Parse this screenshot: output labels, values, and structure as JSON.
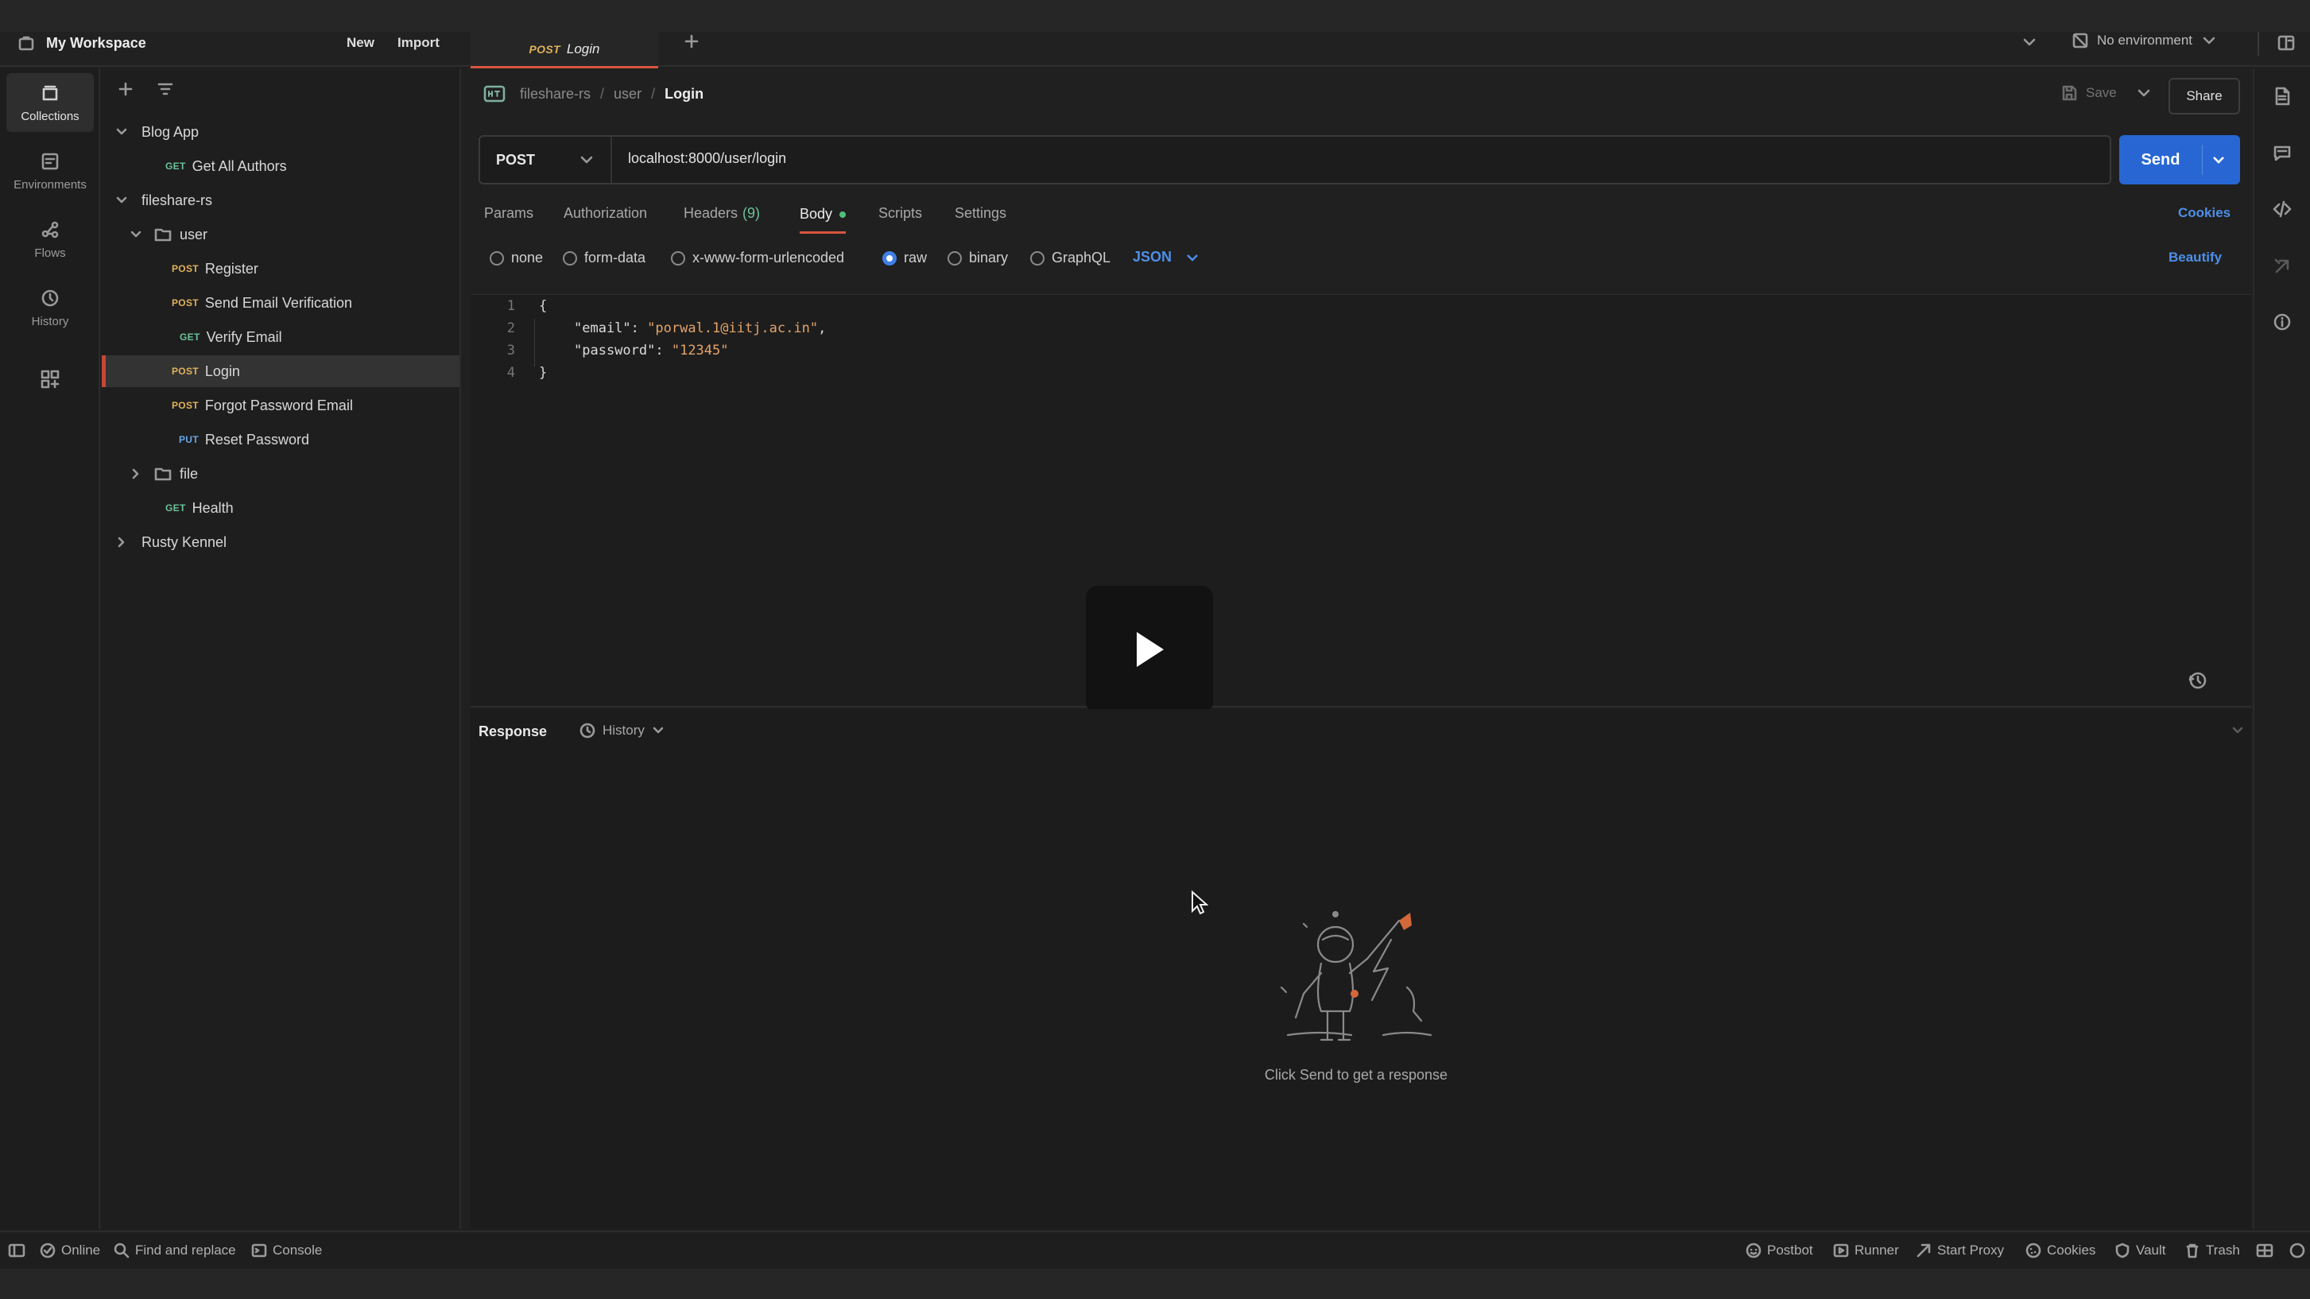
{
  "workspace": {
    "name": "My Workspace",
    "new_label": "New",
    "import_label": "Import"
  },
  "tabs": [
    {
      "method": "POST",
      "label": "Login"
    }
  ],
  "environment": {
    "label": "No environment"
  },
  "rail": {
    "items": [
      {
        "label": "Collections",
        "icon": "collections-icon"
      },
      {
        "label": "Environments",
        "icon": "environments-icon"
      },
      {
        "label": "Flows",
        "icon": "flows-icon"
      },
      {
        "label": "History",
        "icon": "history-icon"
      }
    ]
  },
  "sidebar": {
    "tree": {
      "blog_app": "Blog App",
      "get_all_authors": {
        "method": "GET",
        "label": "Get All Authors"
      },
      "fileshare": "fileshare-rs",
      "user_folder": "user",
      "register": {
        "method": "POST",
        "label": "Register"
      },
      "send_email": {
        "method": "POST",
        "label": "Send Email Verification"
      },
      "verify_email": {
        "method": "GET",
        "label": "Verify Email"
      },
      "login": {
        "method": "POST",
        "label": "Login"
      },
      "forgot": {
        "method": "POST",
        "label": "Forgot Password Email"
      },
      "reset": {
        "method": "PUT",
        "label": "Reset Password"
      },
      "file_folder": "file",
      "health": {
        "method": "GET",
        "label": "Health"
      },
      "rusty": "Rusty Kennel"
    }
  },
  "breadcrumb": {
    "collection": "fileshare-rs",
    "folder": "user",
    "request": "Login",
    "sep": "/"
  },
  "actions": {
    "save": "Save",
    "share": "Share"
  },
  "request": {
    "method": "POST",
    "url": "localhost:8000/user/login",
    "send": "Send"
  },
  "subtabs": {
    "params": "Params",
    "authorization": "Authorization",
    "headers": "Headers",
    "headers_count": "(9)",
    "body": "Body",
    "scripts": "Scripts",
    "settings": "Settings",
    "cookies": "Cookies"
  },
  "body_types": {
    "none": "none",
    "form_data": "form-data",
    "urlencoded": "x-www-form-urlencoded",
    "raw": "raw",
    "binary": "binary",
    "graphql": "GraphQL",
    "format": "JSON",
    "beautify": "Beautify"
  },
  "editor": {
    "line_numbers": [
      "1",
      "2",
      "3",
      "4"
    ],
    "open_brace": "{",
    "close_brace": "}",
    "email_key": "\"email\"",
    "email_value": "\"porwal.1@iitj.ac.in\"",
    "password_key": "\"password\"",
    "password_value": "\"12345\"",
    "colon": ": ",
    "comma": ","
  },
  "response": {
    "title": "Response",
    "history": "History",
    "empty_message": "Click Send to get a response"
  },
  "statusbar": {
    "online": "Online",
    "find_replace": "Find and replace",
    "console": "Console",
    "postbot": "Postbot",
    "runner": "Runner",
    "start_proxy": "Start Proxy",
    "cookies": "Cookies",
    "vault": "Vault",
    "trash": "Trash"
  },
  "colors": {
    "accent_send": "#2867d3",
    "tab_underline": "#d9553d",
    "post": "#e0b25c",
    "get": "#6cc29a",
    "put": "#6aa5e8"
  }
}
